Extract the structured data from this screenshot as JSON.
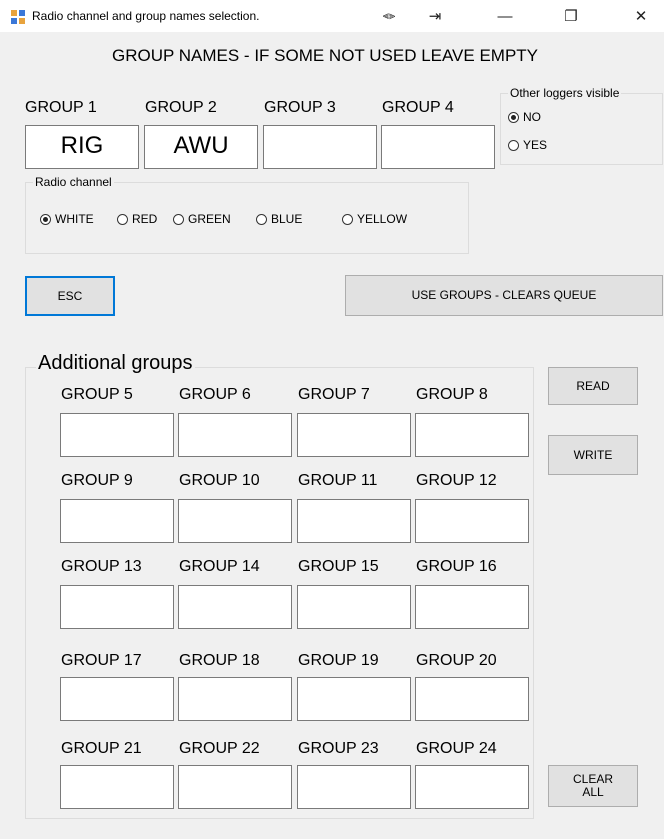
{
  "window": {
    "title": "Radio channel and group names selection.",
    "controls": {
      "extra1": "⫷⫸",
      "extra2": "⇥",
      "minimize": "—",
      "restore": "❐",
      "close": "✕"
    }
  },
  "header": "GROUP NAMES - IF SOME NOT USED LEAVE EMPTY",
  "main_groups": [
    {
      "label": "GROUP 1",
      "value": "RIG"
    },
    {
      "label": "GROUP 2",
      "value": "AWU"
    },
    {
      "label": "GROUP 3",
      "value": ""
    },
    {
      "label": "GROUP 4",
      "value": ""
    }
  ],
  "other_loggers": {
    "title": "Other loggers visible",
    "options": [
      {
        "label": "NO",
        "checked": true
      },
      {
        "label": "YES",
        "checked": false
      }
    ]
  },
  "radio_channel": {
    "title": "Radio channel",
    "options": [
      {
        "label": "WHITE",
        "checked": true
      },
      {
        "label": "RED",
        "checked": false
      },
      {
        "label": "GREEN",
        "checked": false
      },
      {
        "label": "BLUE",
        "checked": false
      },
      {
        "label": "YELLOW",
        "checked": false
      }
    ]
  },
  "buttons": {
    "esc": "ESC",
    "use_groups": "USE GROUPS - CLEARS QUEUE",
    "read": "READ",
    "write": "WRITE",
    "clear_all": "CLEAR ALL"
  },
  "additional": {
    "title": "Additional groups",
    "groups": [
      "GROUP 5",
      "GROUP 6",
      "GROUP 7",
      "GROUP 8",
      "GROUP 9",
      "GROUP 10",
      "GROUP 11",
      "GROUP 12",
      "GROUP 13",
      "GROUP 14",
      "GROUP 15",
      "GROUP 16",
      "GROUP 17",
      "GROUP 18",
      "GROUP 19",
      "GROUP 20",
      "GROUP 21",
      "GROUP 22",
      "GROUP 23",
      "GROUP 24"
    ]
  }
}
